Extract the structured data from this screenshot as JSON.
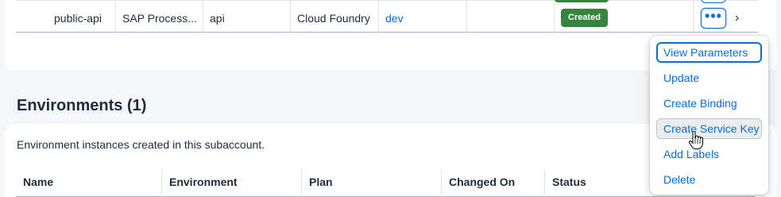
{
  "instances_table": {
    "row": {
      "name": "public-api",
      "service": "SAP Process...",
      "plan": "api",
      "runtime": "Cloud Foundry",
      "scope": "dev",
      "extra": "",
      "status": "Created",
      "more_icon": "more-dots-icon",
      "nav_icon": "chevron-right-icon"
    }
  },
  "environments": {
    "title": "Environments (1)",
    "description": "Environment instances created in this subaccount.",
    "columns": [
      "Name",
      "Environment",
      "Plan",
      "Changed On",
      "Status"
    ]
  },
  "action_menu": {
    "items": [
      "View Parameters",
      "Update",
      "Create Binding",
      "Create Service Key",
      "Add Labels",
      "Delete"
    ],
    "focused_index": 0,
    "hovered_index": 3
  },
  "colors": {
    "link": "#0a6ed1",
    "status_created": "#36853f",
    "text": "#1d2d3e"
  }
}
